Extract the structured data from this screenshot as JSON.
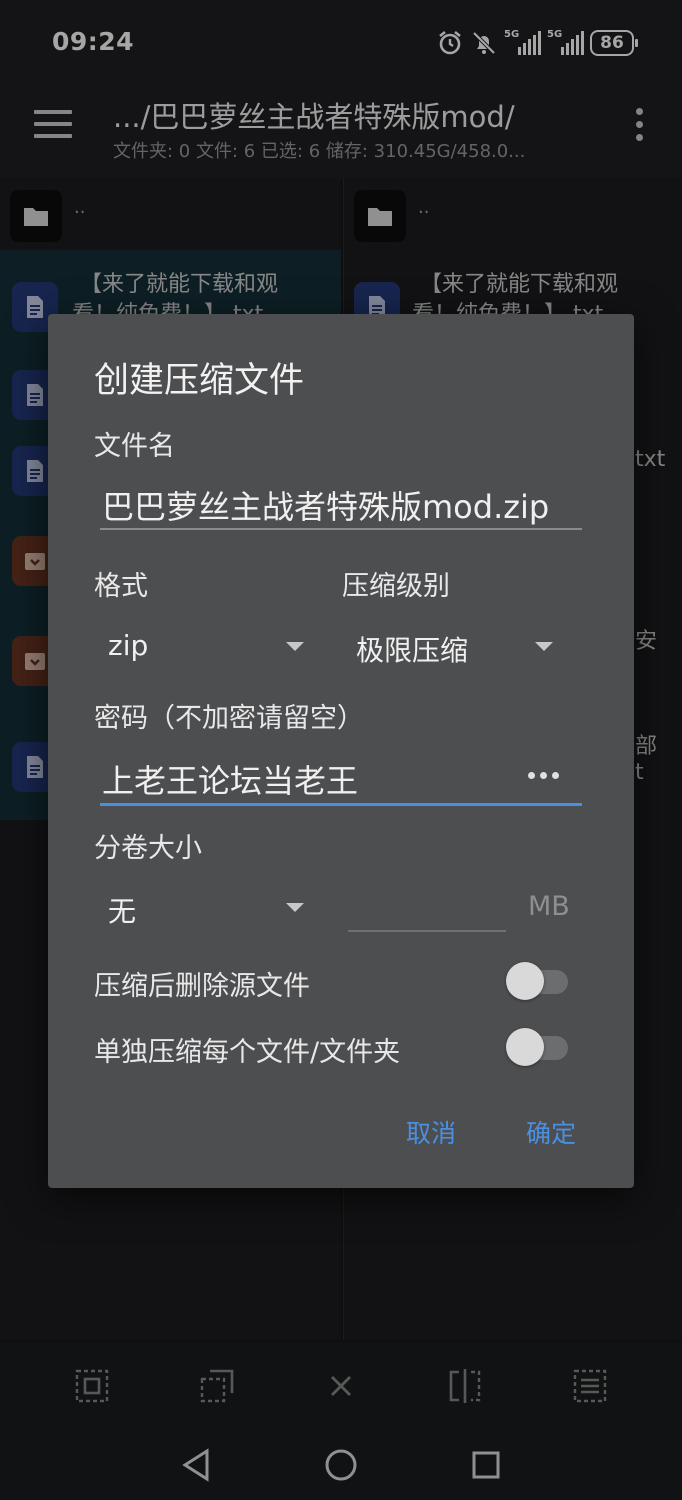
{
  "status": {
    "time": "09:24",
    "battery": "86",
    "network_1": "5G",
    "network_2": "5G"
  },
  "appbar": {
    "title": ".../巴巴萝丝主战者特殊版mod/",
    "subtitle": "文件夹: 0  文件: 6  已选: 6  储存: 310.45G/458.0..."
  },
  "left_pane": {
    "up_label": "..",
    "items": [
      {
        "type": "doc",
        "text": "【来了就能下载和观",
        "text2": "看！纯免费！】.txt"
      },
      {
        "type": "doc",
        "text": ""
      },
      {
        "type": "doc",
        "text": ""
      },
      {
        "type": "archive",
        "text": ""
      },
      {
        "type": "archive",
        "text": ""
      },
      {
        "type": "doc",
        "text": ""
      }
    ]
  },
  "right_pane": {
    "up_label": "..",
    "item_text_1": "【来了就能下载和观",
    "item_text_2": "看！纯免费！】.txt",
    "peek_1": "txt",
    "peek_2": "安",
    "peek_3": "部",
    "peek_4": "t"
  },
  "dialog": {
    "title": "创建压缩文件",
    "filename_label": "文件名",
    "filename_value": "巴巴萝丝主战者特殊版mod.zip",
    "format_label": "格式",
    "format_value": "zip",
    "level_label": "压缩级别",
    "level_value": "极限压缩",
    "password_label": "密码（不加密请留空）",
    "password_value": "上老王论坛当老王",
    "split_label": "分卷大小",
    "split_value": "无",
    "split_unit": "MB",
    "delete_source_label": "压缩后删除源文件",
    "delete_source_on": false,
    "separate_label": "单独压缩每个文件/文件夹",
    "separate_on": false,
    "cancel_label": "取消",
    "ok_label": "确定",
    "accent_color": "#4a90e2"
  }
}
